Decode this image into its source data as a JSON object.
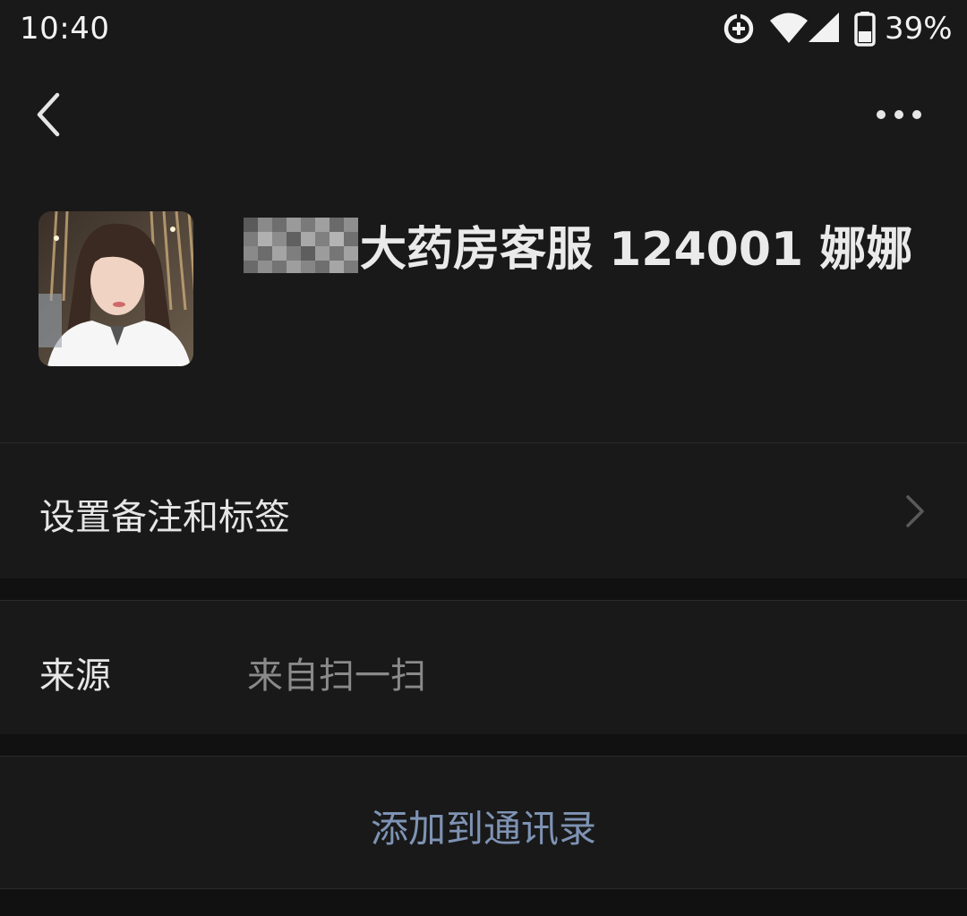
{
  "status_bar": {
    "time": "10:40",
    "battery_percent": "39%",
    "icons": [
      "data-saver-icon",
      "wifi-icon",
      "signal-icon",
      "battery-icon"
    ]
  },
  "nav": {
    "back_icon": "back-chevron-icon",
    "more_icon": "more-dots-icon"
  },
  "profile": {
    "avatar_icon": "avatar-photo",
    "display_name": "大药房客服 124001 娜娜"
  },
  "settings_row": {
    "label": "设置备注和标签",
    "icon": "chevron-right-icon"
  },
  "source_row": {
    "label": "来源",
    "value": "来自扫一扫"
  },
  "add_contact": {
    "label": "添加到通讯录"
  },
  "colors": {
    "background": "#111111",
    "cell_background": "#191919",
    "action_text": "#7e93b4",
    "secondary_text": "#8a8a8a"
  }
}
